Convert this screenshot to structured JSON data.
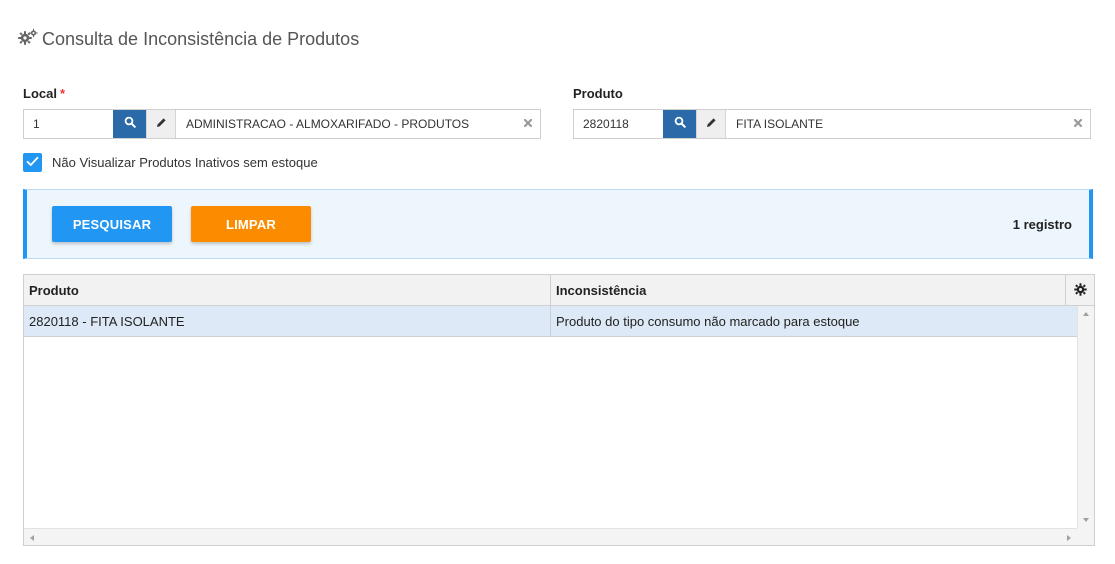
{
  "page": {
    "title": "Consulta de Inconsistência de Produtos"
  },
  "local": {
    "label": "Local",
    "required_mark": "*",
    "code": "1",
    "description": "ADMINISTRACAO - ALMOXARIFADO - PRODUTOS",
    "icons": {
      "search": "search-icon",
      "edit": "pencil-icon",
      "clear": "close-icon"
    }
  },
  "produto": {
    "label": "Produto",
    "code": "2820118",
    "description": "FITA ISOLANTE",
    "icons": {
      "search": "search-icon",
      "edit": "pencil-icon",
      "clear": "close-icon"
    }
  },
  "filter": {
    "checkbox_label": "Não Visualizar Produtos Inativos sem estoque",
    "checked": true
  },
  "actions": {
    "search_label": "PESQUISAR",
    "clear_label": "LIMPAR",
    "record_count": "1 registro"
  },
  "grid": {
    "columns": [
      "Produto",
      "Inconsistência"
    ],
    "rows": [
      {
        "produto": "2820118 - FITA ISOLANTE",
        "inconsistencia": "Produto do tipo consumo não marcado para estoque"
      }
    ]
  },
  "colors": {
    "primary": "#2196f3",
    "accent_orange": "#fb8c00",
    "search_button": "#2a6aa8",
    "selected_row": "#dde9f6",
    "required": "#e53935"
  }
}
